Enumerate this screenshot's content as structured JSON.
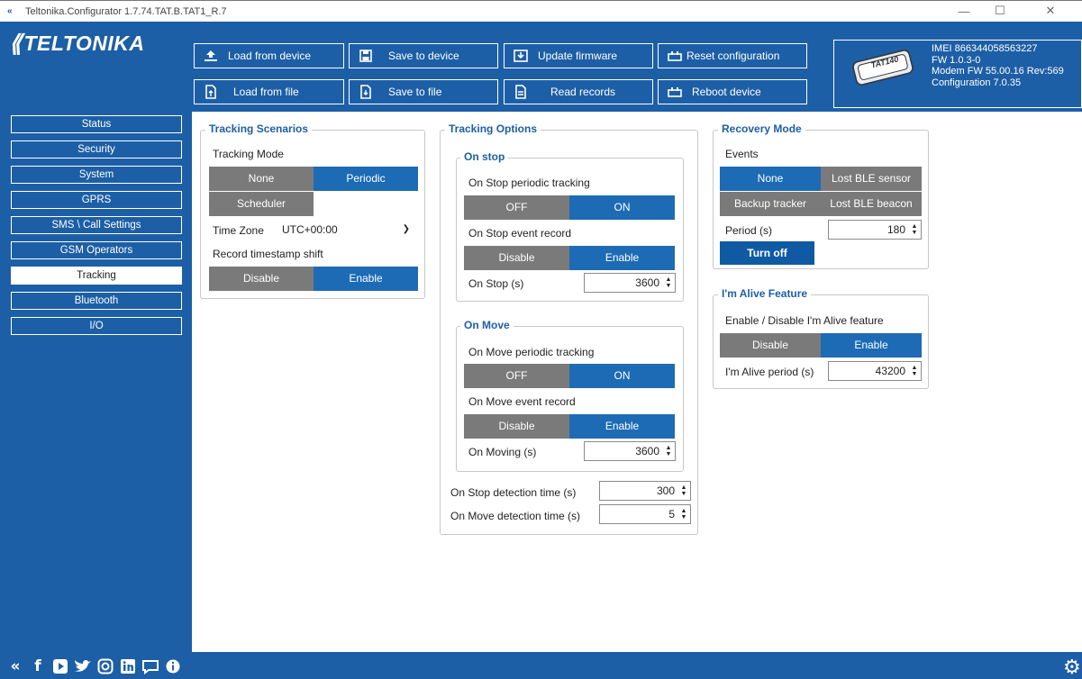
{
  "window": {
    "title": "Teltonika.Configurator 1.7.74.TAT.B.TAT1_R.7",
    "minimize": "—",
    "maximize": "☐",
    "close": "✕"
  },
  "brand": {
    "mark": "⟪",
    "word": "TELTONIKA"
  },
  "toolbar": {
    "load_device": "Load from device",
    "save_device": "Save to device",
    "update_firmware": "Update firmware",
    "reset_config": "Reset configuration",
    "load_file": "Load from file",
    "save_file": "Save to file",
    "read_records": "Read records",
    "reboot": "Reboot device"
  },
  "device": {
    "imei": "IMEI 866344058563227",
    "fw": "FW 1.0.3-0",
    "modem": "Modem FW 55.00.16 Rev:569",
    "config": "Configuration 7.0.35",
    "model_label": "TAT140"
  },
  "nav": {
    "items": [
      "Status",
      "Security",
      "System",
      "GPRS",
      "SMS \\ Call Settings",
      "GSM Operators",
      "Tracking",
      "Bluetooth",
      "I/O"
    ],
    "active": "Tracking"
  },
  "tracking_scenarios": {
    "title": "Tracking Scenarios",
    "mode_label": "Tracking Mode",
    "mode_none": "None",
    "mode_periodic": "Periodic",
    "mode_scheduler": "Scheduler",
    "timezone_label": "Time Zone",
    "timezone_value": "UTC+00:00",
    "shift_label": "Record timestamp shift",
    "shift_disable": "Disable",
    "shift_enable": "Enable"
  },
  "tracking_options": {
    "title": "Tracking Options",
    "on_stop": {
      "title": "On stop",
      "periodic_label": "On Stop periodic tracking",
      "off": "OFF",
      "on": "ON",
      "event_label": "On Stop event record",
      "disable": "Disable",
      "enable": "Enable",
      "period_label": "On Stop  (s)",
      "period_value": "3600"
    },
    "on_move": {
      "title": "On Move",
      "periodic_label": "On Move periodic tracking",
      "off": "OFF",
      "on": "ON",
      "event_label": "On Move event record",
      "disable": "Disable",
      "enable": "Enable",
      "period_label": "On Moving  (s)",
      "period_value": "3600"
    },
    "stop_detect_label": "On Stop detection time  (s)",
    "stop_detect_value": "300",
    "move_detect_label": "On Move detection time  (s)",
    "move_detect_value": "5"
  },
  "recovery_mode": {
    "title": "Recovery Mode",
    "events_label": "Events",
    "none": "None",
    "lost_ble_sensor": "Lost BLE sensor",
    "backup_tracker": "Backup tracker",
    "lost_ble_beacon": "Lost BLE beacon",
    "period_label": "Period  (s)",
    "period_value": "180",
    "turn_off": "Turn off"
  },
  "alive": {
    "title": "I'm Alive Feature",
    "toggle_label": "Enable / Disable I'm Alive feature",
    "disable": "Disable",
    "enable": "Enable",
    "period_label": "I'm Alive period  (s)",
    "period_value": "43200"
  },
  "colors": {
    "brand_blue": "#1d5fa6",
    "active_seg": "#1d6bb5",
    "inactive_seg": "#7a7a7a"
  }
}
